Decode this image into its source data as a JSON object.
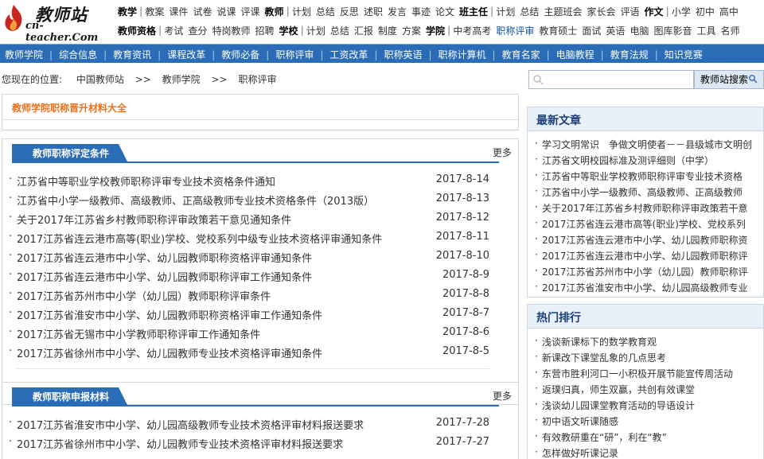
{
  "logo": {
    "cn": "教师站",
    "en": "cn-teacher.Com"
  },
  "toplinks": {
    "row1": [
      {
        "t": "教学",
        "b": true,
        "sep": true
      },
      {
        "t": "教案"
      },
      {
        "t": "课件"
      },
      {
        "t": "试卷"
      },
      {
        "t": "说课"
      },
      {
        "t": "评课"
      },
      {
        "t": "教师",
        "b": true,
        "sep": true
      },
      {
        "t": "计划"
      },
      {
        "t": "总结"
      },
      {
        "t": "反思"
      },
      {
        "t": "述职"
      },
      {
        "t": "发言"
      },
      {
        "t": "事迹"
      },
      {
        "t": "论文"
      },
      {
        "t": "班主任",
        "b": true,
        "sep": true
      },
      {
        "t": "计划"
      },
      {
        "t": "总结"
      },
      {
        "t": "主题班会"
      },
      {
        "t": "家长会"
      },
      {
        "t": "评语"
      },
      {
        "t": "作文",
        "b": true,
        "sep": true
      },
      {
        "t": "小学"
      },
      {
        "t": "初中"
      },
      {
        "t": "高中"
      }
    ],
    "row2": [
      {
        "t": "教师资格",
        "b": true,
        "sep": true
      },
      {
        "t": "考试"
      },
      {
        "t": "查分"
      },
      {
        "t": "特岗教师"
      },
      {
        "t": "招聘"
      },
      {
        "t": "学校",
        "b": true,
        "sep": true
      },
      {
        "t": "计划"
      },
      {
        "t": "总结"
      },
      {
        "t": "汇报"
      },
      {
        "t": "制度"
      },
      {
        "t": "方案"
      },
      {
        "t": "学院",
        "b": true,
        "sep": true
      },
      {
        "t": "中考高考"
      },
      {
        "t": "职称评审",
        "hl": true
      },
      {
        "t": "教育硕士"
      },
      {
        "t": "面试"
      },
      {
        "t": "英语"
      },
      {
        "t": "电脑"
      },
      {
        "t": "图库影音"
      },
      {
        "t": "工具"
      },
      {
        "t": "名师"
      }
    ]
  },
  "nav": [
    "教师学院",
    "综合信息",
    "教育资讯",
    "课程改革",
    "教师必备",
    "职称评审",
    "工资改革",
    "职称英语",
    "职称计算机",
    "教育名家",
    "电脑教程",
    "教育法规",
    "知识竞赛"
  ],
  "breadcrumb": {
    "label": "您现在的位置:",
    "items": [
      "中国教师站",
      "教师学院",
      "职称评审"
    ],
    "arrow": ">>"
  },
  "search": {
    "button": "教师站搜索"
  },
  "banner": {
    "title": "教师学院职称晋升材料大全"
  },
  "sections": [
    {
      "title": "教师职称评定条件",
      "more": "更多",
      "items": [
        {
          "text": "江苏省中等职业学校教师职称评审专业技术资格条件通知",
          "date": "2017-8-14"
        },
        {
          "text": "江苏省中小学一级教师、高级教师、正高级教师专业技术资格条件（2013版）",
          "date": "2017-8-13"
        },
        {
          "text": "关于2017年江苏省乡村教师职称评审政策若干意见通知条件",
          "date": "2017-8-12"
        },
        {
          "text": "2017江苏省连云港市高等(职业)学校、党校系列中级专业技术资格评审通知条件",
          "date": "2017-8-11"
        },
        {
          "text": "2017江苏省连云港市中小学、幼儿园教师职称资格评审通知条件",
          "date": "2017-8-10"
        },
        {
          "text": "2017江苏省连云港市中小学、幼儿园教师职称评审工作通知条件",
          "date": "2017-8-9"
        },
        {
          "text": "2017江苏省苏州市中小学（幼儿园）教师职称评审条件",
          "date": "2017-8-8"
        },
        {
          "text": "2017江苏省淮安市中小学、幼儿园教师职称资格评审工作通知条件",
          "date": "2017-8-7"
        },
        {
          "text": "2017江苏省无锡市中小学教师职称评审工作通知条件",
          "date": "2017-8-6"
        },
        {
          "text": "2017江苏省徐州市中小学、幼儿园教师专业技术资格评审通知条件",
          "date": "2017-8-5"
        }
      ]
    },
    {
      "title": "教师职称申报材料",
      "more": "更多",
      "items": [
        {
          "text": "2017江苏省淮安市中小学、幼儿园高级教师专业技术资格评审材料报送要求",
          "date": "2017-7-28"
        },
        {
          "text": "2017江苏省徐州市中小学、幼儿园教师专业技术资格评审材料报送要求",
          "date": "2017-7-27"
        }
      ]
    }
  ],
  "latest": {
    "title": "最新文章",
    "items": [
      "学习文明常识　争做文明使者－－县级城市文明创",
      "江苏省文明校园标准及测评细则（中学）",
      "江苏省中等职业学校教师职称评审专业技术资格",
      "江苏省中小学一级教师、高级教师、正高级教师",
      "关于2017年江苏省乡村教师职称评审政策若干意",
      "2017江苏省连云港市高等(职业)学校、党校系列",
      "2017江苏省连云港市中小学、幼儿园教师职称资",
      "2017江苏省连云港市中小学、幼儿园教师职称评",
      "2017江苏省苏州市中小学（幼儿园）教师职称评",
      "2017江苏省淮安市中小学、幼儿园高级教师专业"
    ]
  },
  "hot": {
    "title": "热门排行",
    "items": [
      "浅谈新课标下的数学教育观",
      "新课改下课堂乱象的几点思考",
      "东营市胜利河口一小积极开展节能宣传周活动",
      "返璞归真，师生双赢，共创有效课堂",
      "浅谈幼儿园课堂教育活动的导语设计",
      "初中语文听课随感",
      "有效教研重在“研”，利在“教”",
      "怎样做好听课记录"
    ]
  }
}
